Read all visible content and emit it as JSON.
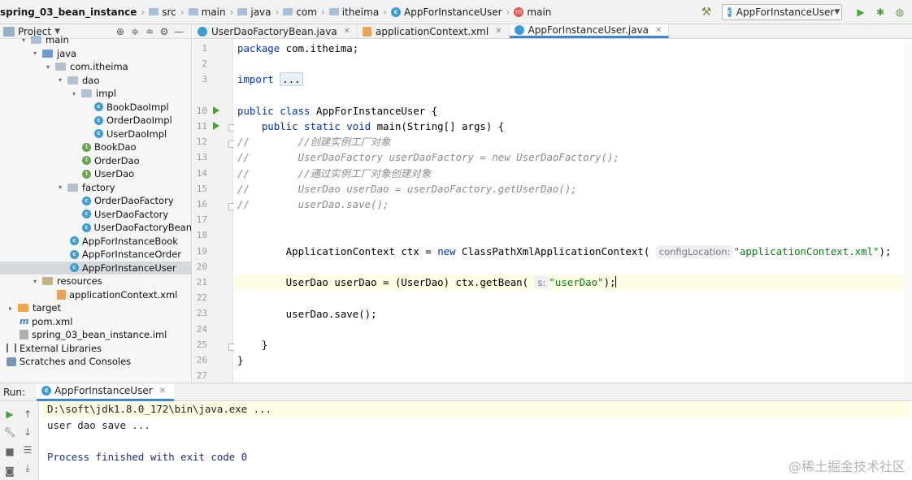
{
  "navbar": {
    "crumbs": [
      "spring_03_bean_instance",
      "src",
      "main",
      "java",
      "com",
      "itheima",
      "AppForInstanceUser",
      "main"
    ],
    "run_config": "AppForInstanceUser"
  },
  "project": {
    "title": "Project",
    "tree": [
      {
        "label": "main"
      },
      {
        "label": "java"
      },
      {
        "label": "com.itheima"
      },
      {
        "label": "dao"
      },
      {
        "label": "impl"
      },
      {
        "label": "BookDaoImpl"
      },
      {
        "label": "OrderDaoImpl"
      },
      {
        "label": "UserDaoImpl"
      },
      {
        "label": "BookDao"
      },
      {
        "label": "OrderDao"
      },
      {
        "label": "UserDao"
      },
      {
        "label": "factory"
      },
      {
        "label": "OrderDaoFactory"
      },
      {
        "label": "UserDaoFactory"
      },
      {
        "label": "UserDaoFactoryBean"
      },
      {
        "label": "AppForInstanceBook"
      },
      {
        "label": "AppForInstanceOrder"
      },
      {
        "label": "AppForInstanceUser"
      },
      {
        "label": "resources"
      },
      {
        "label": "applicationContext.xml"
      },
      {
        "label": "target"
      },
      {
        "label": "pom.xml"
      },
      {
        "label": "spring_03_bean_instance.iml"
      },
      {
        "label": "External Libraries"
      },
      {
        "label": "Scratches and Consoles"
      }
    ]
  },
  "editor": {
    "tabs": [
      "UserDaoFactoryBean.java",
      "applicationContext.xml",
      "AppForInstanceUser.java"
    ],
    "line_numbers": [
      "1",
      "2",
      "3",
      "10",
      "11",
      "12",
      "13",
      "14",
      "15",
      "16",
      "17",
      "18",
      "19",
      "20",
      "21",
      "22",
      "23",
      "24",
      "25",
      "26",
      "27"
    ],
    "code": {
      "l1_kw": "package",
      "l1_rest": " com.itheima;",
      "l3_kw": "import",
      "l3_fold": "...",
      "l10_kw": "public class",
      "l10_rest": " AppForInstanceUser {",
      "l11_kw": "public static void",
      "l11_rest": " main(String[] args) {",
      "l12": "//        //创建实例工厂对象",
      "l13": "//        UserDaoFactory userDaoFactory = new UserDaoFactory();",
      "l14": "//        //通过实例工厂对象创建对象",
      "l15": "//        UserDao userDao = userDaoFactory.getUserDao();",
      "l16": "//        userDao.save();",
      "l19_a": "        ApplicationContext ctx = ",
      "l19_kw": "new",
      "l19_b": " ClassPathXmlApplicationContext(",
      "l19_hint": "configLocation:",
      "l19_str": "\"applicationContext.xml\"",
      "l19_end": ");",
      "l21_a": "        UserDao userDao = (UserDao) ctx.getBean(",
      "l21_hint": "s:",
      "l21_str": "\"userDao\"",
      "l21_end": ");",
      "l23": "        userDao.save();",
      "l25": "    }",
      "l26": "}"
    }
  },
  "run": {
    "label": "Run:",
    "tab": "AppForInstanceUser",
    "console": [
      "D:\\soft\\jdk1.8.0_172\\bin\\java.exe ...",
      "user dao save ...",
      "",
      "Process finished with exit code 0"
    ]
  },
  "watermark": "@稀土掘金技术社区"
}
